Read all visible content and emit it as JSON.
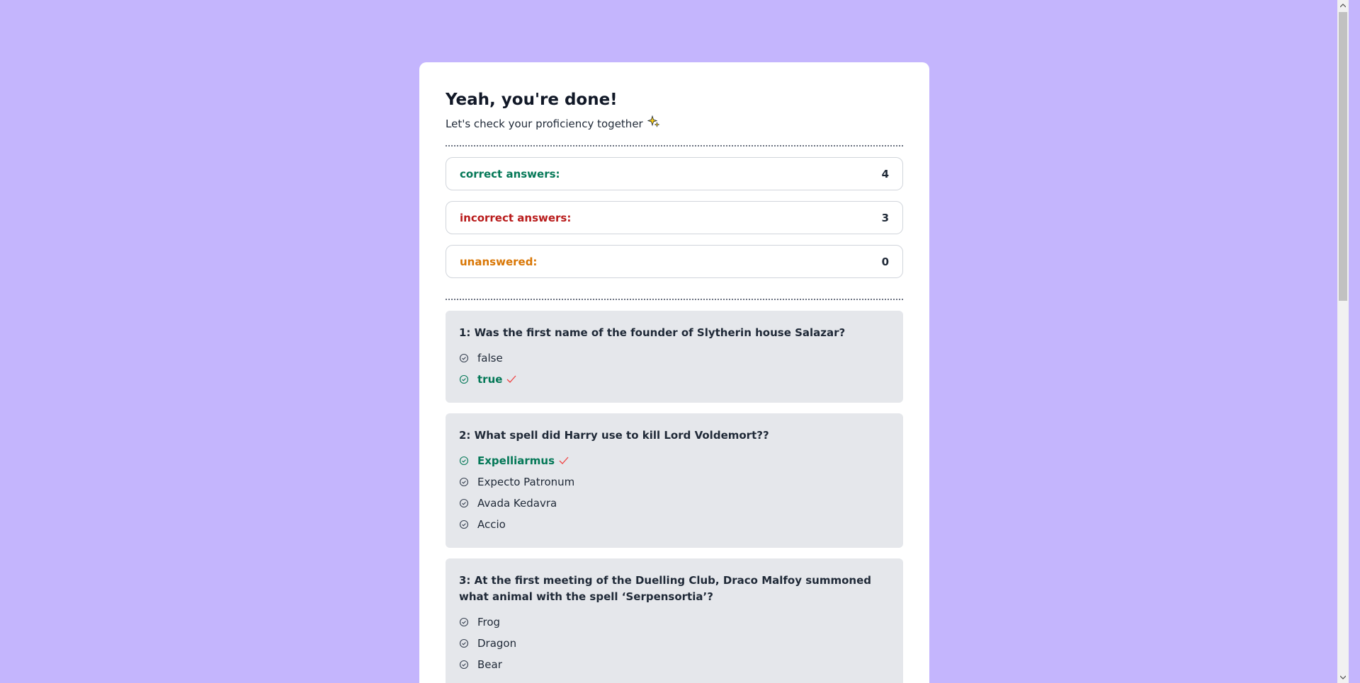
{
  "header": {
    "title": "Yeah, you're done!",
    "subtitle": "Let's check your proficiency together",
    "subtitle_icon": "sparkle-icon"
  },
  "stats": [
    {
      "label": "correct answers:",
      "value": "4",
      "color": "#047857"
    },
    {
      "label": "incorrect answers:",
      "value": "3",
      "color": "#b91c1c"
    },
    {
      "label": "unanswered:",
      "value": "0",
      "color": "#d97706"
    }
  ],
  "questions": [
    {
      "title": "1: Was the first name of the founder of Slytherin house Salazar?",
      "options": [
        {
          "label": "false",
          "correct": false
        },
        {
          "label": "true",
          "correct": true
        }
      ]
    },
    {
      "title": "2: What spell did Harry use to kill Lord Voldemort??",
      "options": [
        {
          "label": "Expelliarmus",
          "correct": true
        },
        {
          "label": "Expecto Patronum",
          "correct": false
        },
        {
          "label": "Avada Kedavra",
          "correct": false
        },
        {
          "label": "Accio",
          "correct": false
        }
      ]
    },
    {
      "title": "3: At the first meeting of the Duelling Club, Draco Malfoy summoned what animal with the spell ‘Serpensortia’?",
      "options": [
        {
          "label": "Frog",
          "correct": false
        },
        {
          "label": "Dragon",
          "correct": false
        },
        {
          "label": "Bear",
          "correct": false
        }
      ]
    }
  ],
  "colors": {
    "background": "#c4b5fd",
    "card": "#ffffff",
    "question_bg": "#e5e7eb",
    "correct": "#047857",
    "tick": "#ef4444"
  }
}
